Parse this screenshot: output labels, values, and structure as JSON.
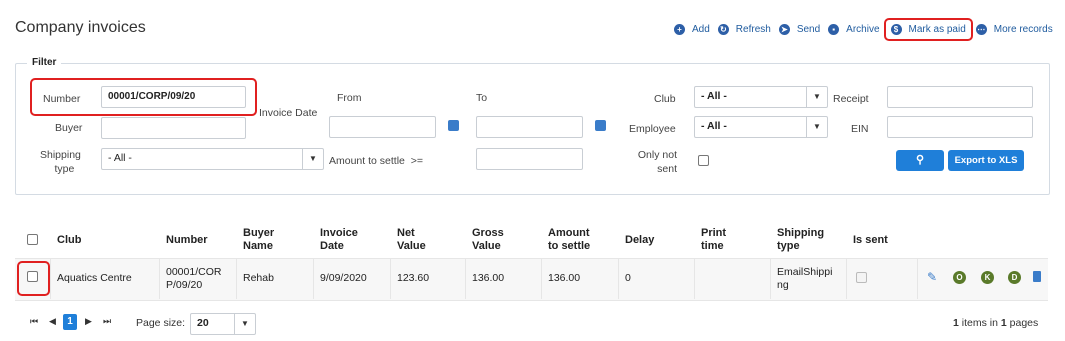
{
  "page": {
    "title": "Company invoices"
  },
  "actions": [
    {
      "label": "Add",
      "icon": "add-icon"
    },
    {
      "label": "Refresh",
      "icon": "refresh-icon"
    },
    {
      "label": "Send",
      "icon": "send-icon"
    },
    {
      "label": "Archive",
      "icon": "archive-icon"
    },
    {
      "label": "Mark as paid",
      "icon": "mark-paid-icon"
    },
    {
      "label": "More records",
      "icon": "more-records-icon"
    }
  ],
  "filter": {
    "legend": "Filter",
    "number_label": "Number",
    "number_value": "00001/CORP/09/20",
    "buyer_label": "Buyer",
    "buyer_value": "",
    "shipping_label_1": "Shipping",
    "shipping_label_2": "type",
    "shipping_value": "- All -",
    "invoice_date_label": "Invoice Date",
    "from_label": "From",
    "to_label": "To",
    "amount_label": "Amount to settle",
    "amount_op": ">=",
    "club_label": "Club",
    "club_value": "- All -",
    "employee_label": "Employee",
    "employee_value": "- All -",
    "only_not_sent_1": "Only not",
    "only_not_sent_2": "sent",
    "receipt_label": "Receipt",
    "ein_label": "EIN",
    "export_label": "Export to XLS"
  },
  "table": {
    "headers": [
      "Club",
      "Number",
      "Buyer Name",
      "Invoice Date",
      "Net Value",
      "Gross Value",
      "Amount to settle",
      "Delay",
      "Print time",
      "Shipping type",
      "Is sent"
    ],
    "header_lines": {
      "buyer": [
        "Buyer",
        "Name"
      ],
      "invoice_date": [
        "Invoice",
        "Date"
      ],
      "net": [
        "Net",
        "Value"
      ],
      "gross": [
        "Gross",
        "Value"
      ],
      "amount": [
        "Amount",
        "to settle"
      ],
      "print": [
        "Print",
        "time"
      ],
      "shipping": [
        "Shipping",
        "type"
      ]
    },
    "rows": [
      {
        "club": "Aquatics Centre",
        "number_lines": [
          "00001/COR",
          "P/09/20"
        ],
        "buyer": "Rehab",
        "invoice_date": "9/09/2020",
        "net": "123.60",
        "gross": "136.00",
        "amount": "136.00",
        "delay": "0",
        "print_time": "",
        "shipping_lines": [
          "EmailShippi",
          "ng"
        ],
        "row_buttons": [
          "O",
          "K",
          "D"
        ]
      }
    ]
  },
  "pager": {
    "current_page": "1",
    "page_size_label": "Page size:",
    "page_size": "20",
    "count": "1",
    "items_in": "items in",
    "pages_count": "1",
    "pages_label": "pages"
  },
  "colors": {
    "accent": "#1f7fd9",
    "highlight": "#e02020",
    "action_text": "#1f5b9e",
    "row_button": "#5a7a2a"
  }
}
